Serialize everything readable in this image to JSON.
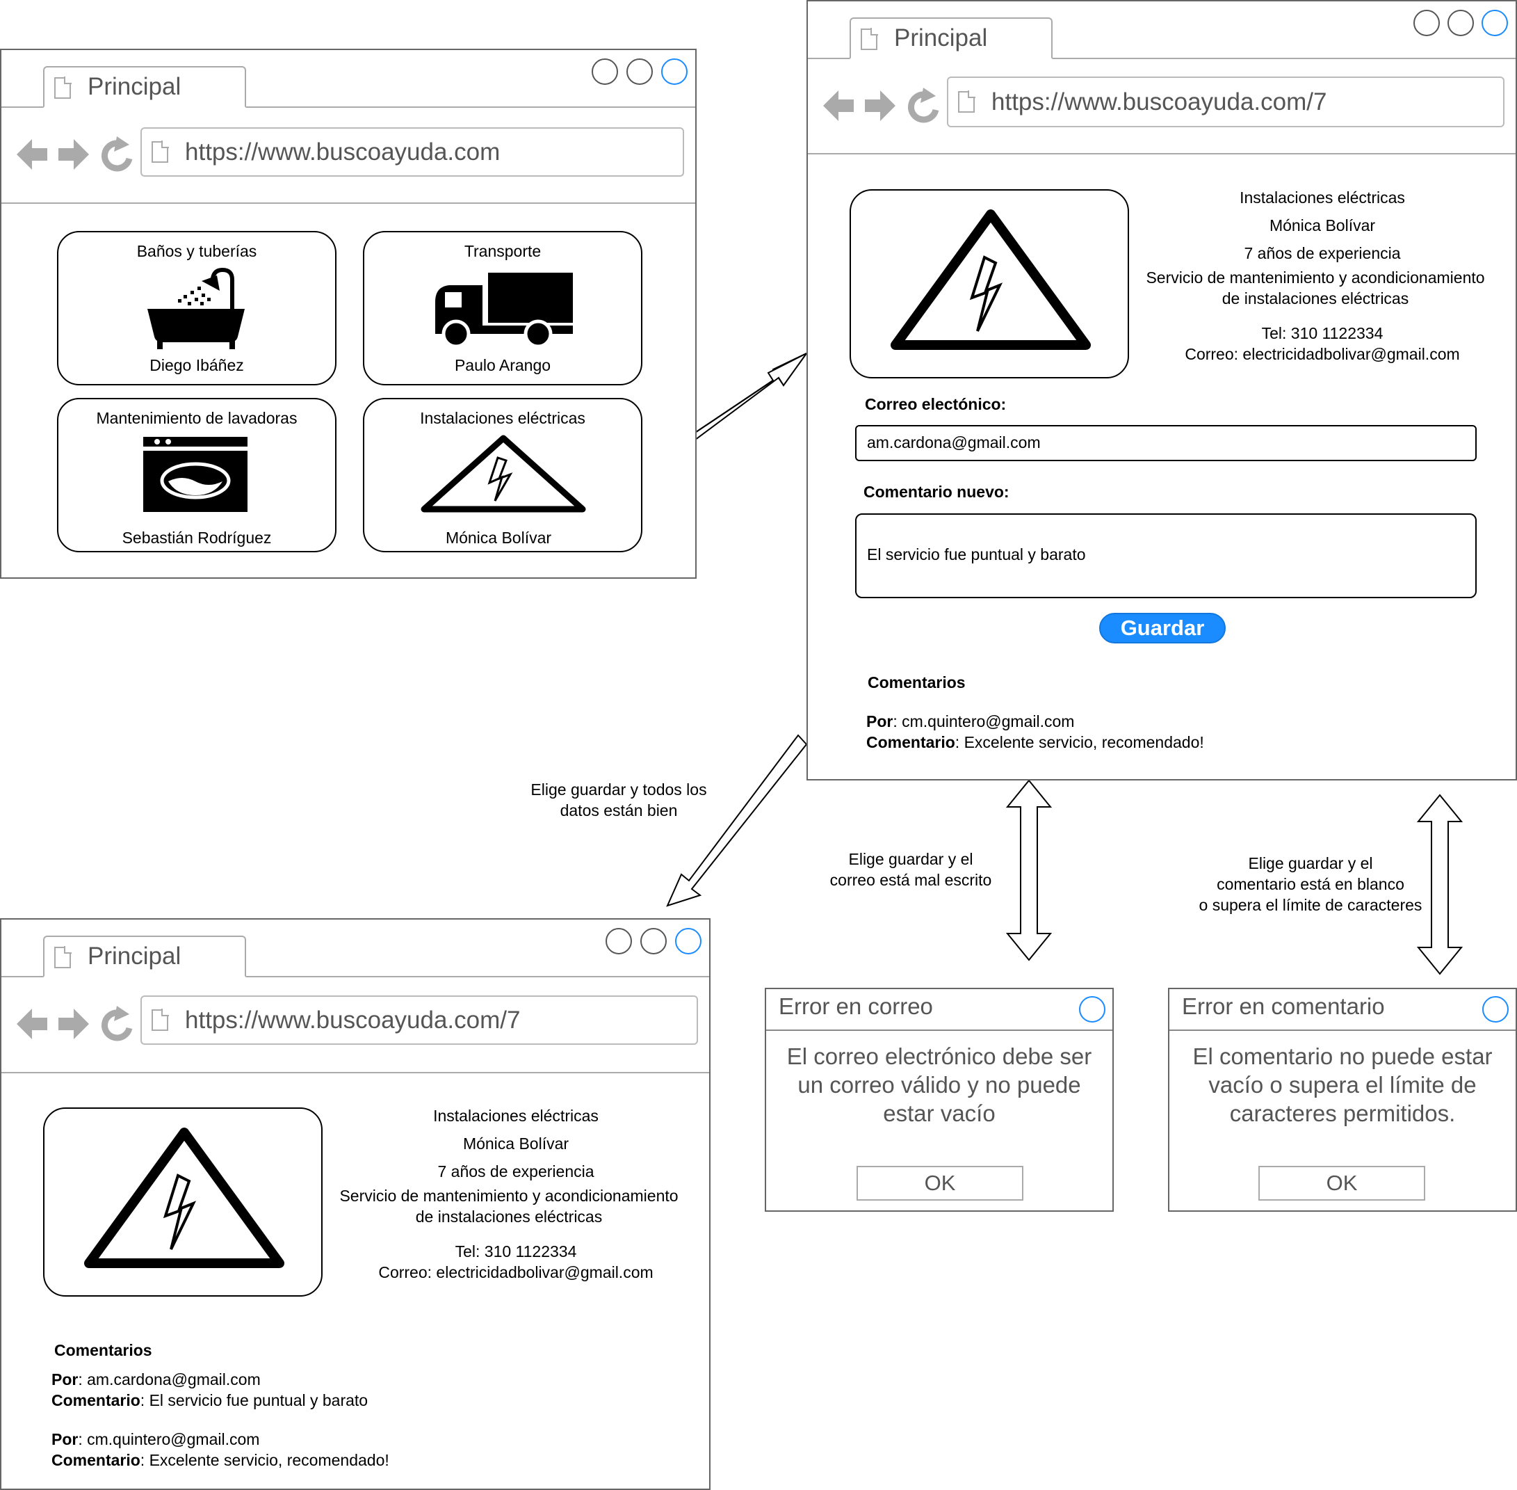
{
  "windows": {
    "home": {
      "tab_title": "Principal",
      "url": "https://www.buscoayuda.com",
      "cards": [
        {
          "category": "Baños y tuberías",
          "provider": "Diego Ibáñez",
          "icon": "bathtub-icon"
        },
        {
          "category": "Transporte",
          "provider": "Paulo Arango",
          "icon": "truck-icon"
        },
        {
          "category": "Mantenimiento de lavadoras",
          "provider": "Sebastián Rodríguez",
          "icon": "washing-machine-icon"
        },
        {
          "category": "Instalaciones eléctricas",
          "provider": "Mónica Bolívar",
          "icon": "electric-hazard-icon"
        }
      ]
    },
    "detail": {
      "tab_title": "Principal",
      "url": "https://www.buscoayuda.com/7",
      "info": {
        "category": "Instalaciones eléctricas",
        "name": "Mónica Bolívar",
        "experience": "7 años de experiencia",
        "description_line1": "Servicio de mantenimiento y acondicionamiento",
        "description_line2": "de instalaciones eléctricas",
        "phone": "Tel: 310 1122334",
        "email": "Correo: electricidadbolivar@gmail.com"
      },
      "email_label": "Correo electónico:",
      "email_value": "am.cardona@gmail.com",
      "comment_label": "Comentario nuevo:",
      "comment_value": "El servicio fue puntual y barato",
      "save_label": "Guardar",
      "comments_title": "Comentarios",
      "by_label": "Por",
      "comment_key": "Comentario",
      "comments": [
        {
          "by": ": cm.quintero@gmail.com",
          "text": ": Excelente servicio, recomendado!"
        }
      ]
    },
    "result": {
      "tab_title": "Principal",
      "url": "https://www.buscoayuda.com/7",
      "comments_title": "Comentarios",
      "comments": [
        {
          "by": ": am.cardona@gmail.com",
          "text": ": El servicio fue puntual y barato"
        },
        {
          "by": ": cm.quintero@gmail.com",
          "text": ": Excelente servicio, recomendado!"
        }
      ]
    }
  },
  "dialogs": {
    "email_error": {
      "title": "Error en correo",
      "message_line1": "El correo electrónico debe ser",
      "message_line2": "un correo válido y no puede",
      "message_line3": "estar vacío",
      "ok": "OK"
    },
    "comment_error": {
      "title": "Error en comentario",
      "message_line1": "El comentario no puede estar",
      "message_line2": "vacío o supera el límite de",
      "message_line3": "caracteres permitidos.",
      "ok": "OK"
    }
  },
  "annotations": {
    "save_ok_line1": "Elige guardar y todos los",
    "save_ok_line2": "datos están bien",
    "bad_email_line1": "Elige guardar y el",
    "bad_email_line2": "correo está mal escrito",
    "bad_comment_line1": "Elige guardar y el",
    "bad_comment_line2": "comentario está en blanco",
    "bad_comment_line3": "o supera el límite de caracteres"
  },
  "colors": {
    "accent": "#1a8cff",
    "frame": "#666666",
    "chrome_text": "#555555"
  }
}
